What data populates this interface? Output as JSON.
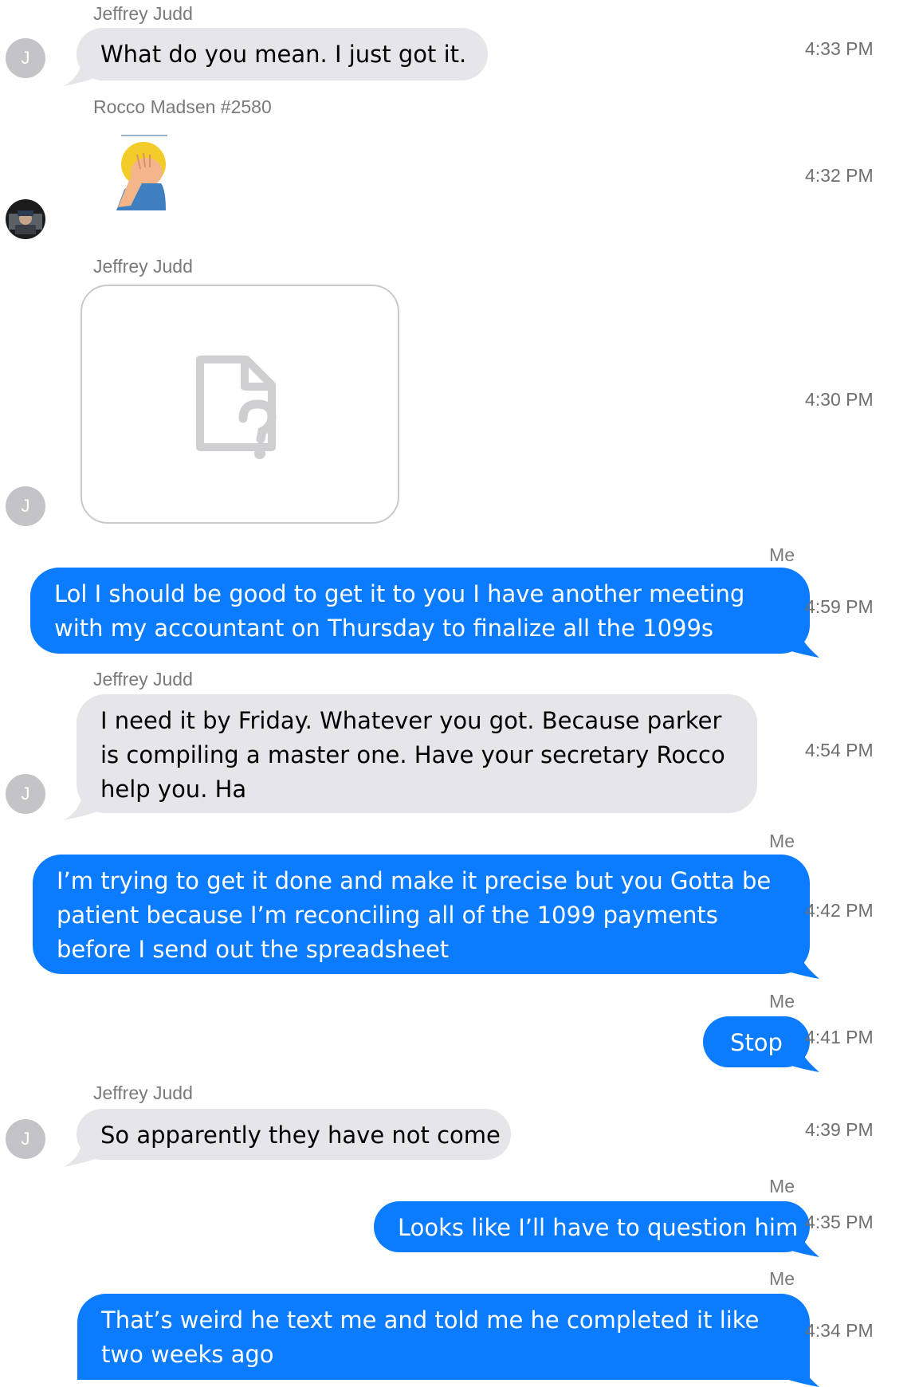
{
  "messages": [
    {
      "kind": "incoming",
      "sender": "Jeffrey Judd",
      "avatar_initial": "J",
      "text": "What do you mean. I just got it.",
      "time": "4:33 PM"
    },
    {
      "kind": "incoming-emoji",
      "sender": "Rocco Madsen #2580",
      "emoji": "facepalm-emoji",
      "time": "4:32 PM"
    },
    {
      "kind": "incoming-attachment",
      "sender": "Jeffrey Judd",
      "avatar_initial": "J",
      "attachment_icon": "missing-file-icon",
      "time": "4:30 PM"
    },
    {
      "kind": "outgoing",
      "sender": "Me",
      "text": "Lol I should be good to get it to you I have another meeting with my accountant on Thursday to finalize all the 1099s",
      "time": "4:59 PM"
    },
    {
      "kind": "incoming",
      "sender": "Jeffrey Judd",
      "avatar_initial": "J",
      "text": "I need it by Friday. Whatever you got. Because parker is compiling a master one. Have your secretary Rocco help you. Ha",
      "time": "4:54 PM"
    },
    {
      "kind": "outgoing",
      "sender": "Me",
      "text": "I’m trying to get it done and make it precise but you Gotta be patient because I’m reconciling all of the 1099 payments before I send out the spreadsheet",
      "time": "4:42 PM"
    },
    {
      "kind": "outgoing",
      "sender": "Me",
      "text": "Stop",
      "time": "4:41 PM"
    },
    {
      "kind": "incoming",
      "sender": "Jeffrey Judd",
      "avatar_initial": "J",
      "text": "So apparently they have not come",
      "time": "4:39 PM"
    },
    {
      "kind": "outgoing",
      "sender": "Me",
      "text": "Looks like I’ll have to question him",
      "time": "4:35 PM"
    },
    {
      "kind": "outgoing",
      "sender": "Me",
      "text": "That’s weird he text me and told me he completed it like two weeks ago",
      "time": "4:34 PM"
    }
  ],
  "colors": {
    "incoming_bubble": "#e5e5ea",
    "outgoing_bubble": "#0b7cff",
    "avatar": "#c4c4c8",
    "meta_text": "#7a7a7a"
  }
}
